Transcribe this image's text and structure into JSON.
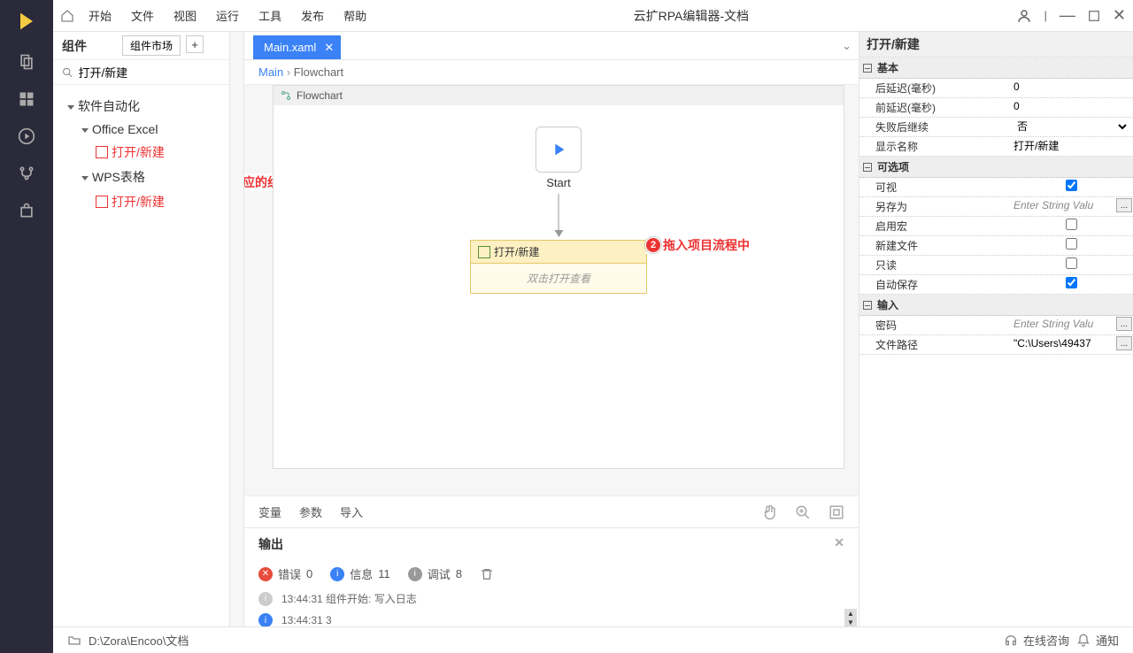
{
  "menus": [
    "开始",
    "文件",
    "视图",
    "运行",
    "工具",
    "发布",
    "帮助"
  ],
  "app_title": "云扩RPA编辑器-文档",
  "components": {
    "title": "组件",
    "market": "组件市场",
    "search_value": "打开/新建",
    "tree": {
      "root": "软件自动化",
      "excel": "Office Excel",
      "excel_leaf": "打开/新建",
      "wps": "WPS表格",
      "wps_leaf": "打开/新建"
    }
  },
  "annotations": {
    "a1": "搜索对应的组件",
    "a2": "拖入项目流程中"
  },
  "tab": {
    "name": "Main.xaml"
  },
  "breadcrumb": {
    "main": "Main",
    "flow": "Flowchart"
  },
  "flowchart": {
    "title": "Flowchart",
    "start": "Start",
    "activity_title": "打开/新建",
    "activity_hint": "双击打开查看"
  },
  "bottom_tabs": {
    "vars": "变量",
    "params": "参数",
    "imports": "导入"
  },
  "props": {
    "title": "打开/新建",
    "sections": {
      "basic": "基本",
      "optional": "可选项",
      "input": "输入"
    },
    "basic": {
      "delay_after": {
        "label": "后延迟(毫秒)",
        "value": "0"
      },
      "delay_before": {
        "label": "前延迟(毫秒)",
        "value": "0"
      },
      "on_fail": {
        "label": "失败后继续",
        "value": "否"
      },
      "display_name": {
        "label": "显示名称",
        "value": "打开/新建"
      }
    },
    "optional": {
      "visible": "可视",
      "save_as": {
        "label": "另存为",
        "placeholder": "Enter String Valu"
      },
      "enable_macro": "启用宏",
      "new_file": "新建文件",
      "readonly": "只读",
      "autosave": "自动保存"
    },
    "input": {
      "password": {
        "label": "密码",
        "placeholder": "Enter String Valu"
      },
      "filepath": {
        "label": "文件路径",
        "value": "\"C:\\Users\\49437"
      }
    }
  },
  "output": {
    "title": "输出",
    "error": {
      "label": "错误",
      "count": "0"
    },
    "info": {
      "label": "信息",
      "count": "11"
    },
    "debug": {
      "label": "调试",
      "count": "8"
    },
    "log1": "13:44:31 组件开始: 写入日志",
    "log2": "13:44:31 3"
  },
  "status": {
    "path": "D:\\Zora\\Encoo\\文档",
    "consult": "在线咨询",
    "notify": "通知"
  }
}
